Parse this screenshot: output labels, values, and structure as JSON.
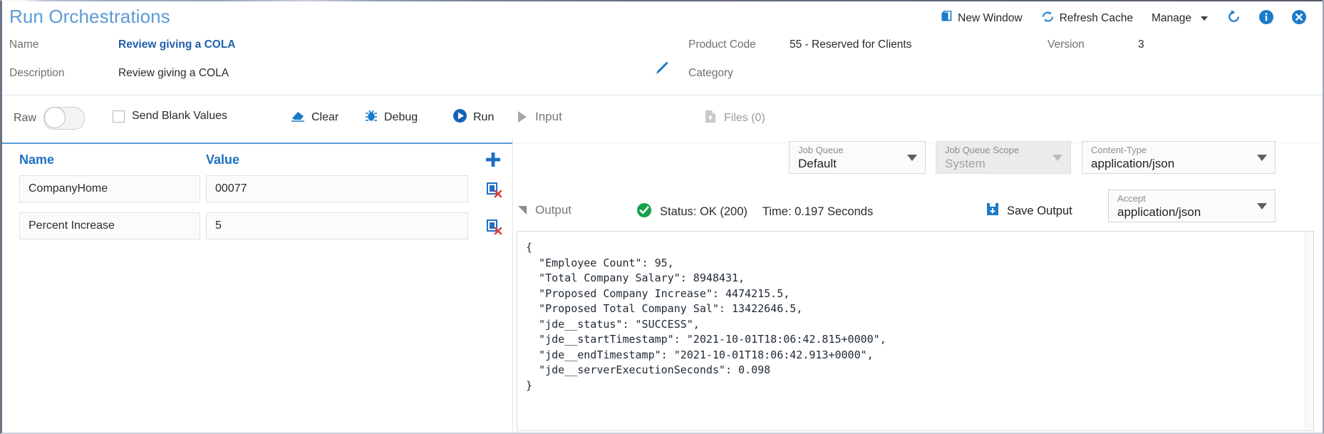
{
  "header": {
    "title": "Run Orchestrations",
    "toolbar": [
      {
        "label": "New Window",
        "icon": "new-window-icon"
      },
      {
        "label": "Refresh Cache",
        "icon": "refresh-cache-icon"
      },
      {
        "label": "Manage",
        "icon": "chevron-down-icon"
      }
    ],
    "icons": [
      {
        "name": "reset-icon"
      },
      {
        "name": "info-icon"
      },
      {
        "name": "close-icon"
      }
    ],
    "fields": {
      "name_label": "Name",
      "name_value": "Review giving a COLA",
      "description_label": "Description",
      "description_value": "Review giving a COLA",
      "product_code_label": "Product Code",
      "product_code_value": "55 - Reserved for Clients",
      "version_label": "Version",
      "version_value": "3",
      "category_label": "Category"
    }
  },
  "actionbar": {
    "raw_label": "Raw",
    "raw_on": "off",
    "send_blank_label": "Send Blank Values",
    "send_blank_checked": "unchecked",
    "clear_label": "Clear",
    "debug_label": "Debug",
    "run_label": "Run",
    "input_label": "Input",
    "files_label": "Files (0)"
  },
  "selects": {
    "job_queue": {
      "label": "Job Queue",
      "value": "Default",
      "disabled": "false"
    },
    "job_queue_scope": {
      "label": "Job Queue Scope",
      "value": "System",
      "disabled": "true"
    },
    "content_type": {
      "label": "Content-Type",
      "value": "application/json",
      "disabled": "false"
    },
    "accept": {
      "label": "Accept",
      "value": "application/json",
      "disabled": "false"
    }
  },
  "grid": {
    "columns": [
      "Name",
      "Value"
    ],
    "rows": [
      {
        "name": "CompanyHome",
        "value": "00077"
      },
      {
        "name": "Percent Increase",
        "value": "5"
      }
    ]
  },
  "output": {
    "label": "Output",
    "status": "Status: OK (200)",
    "time": "Time: 0.197 Seconds",
    "save_label": "Save Output",
    "status_color": "#16a34a",
    "body": "{\n  \"Employee Count\": 95,\n  \"Total Company Salary\": 8948431,\n  \"Proposed Company Increase\": 4474215.5,\n  \"Proposed Total Company Sal\": 13422646.5,\n  \"jde__status\": \"SUCCESS\",\n  \"jde__startTimestamp\": \"2021-10-01T18:06:42.815+0000\",\n  \"jde__endTimestamp\": \"2021-10-01T18:06:42.913+0000\",\n  \"jde__serverExecutionSeconds\": 0.098\n}"
  },
  "colors": {
    "title_blue": "#5b9bd5",
    "accent_blue": "#1f6fc4",
    "icon_blue": "#1a7bc9",
    "success_green": "#16a34a"
  }
}
